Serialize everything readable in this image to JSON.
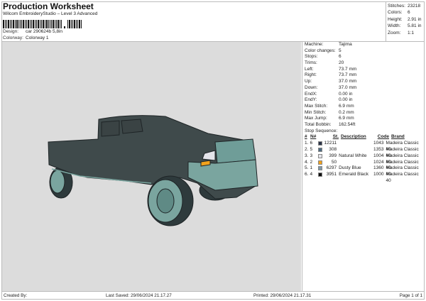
{
  "header": {
    "title": "Production Worksheet",
    "subtitle": "Wilcom EmbroideryStudio – Level 3 Advanced",
    "design_label": "Design:",
    "design_value": "car 290624b 5,8in",
    "colorway_label": "Colorway:",
    "colorway_value": "Colorway 1"
  },
  "stats": [
    {
      "label": "Stitches:",
      "value": "23218"
    },
    {
      "label": "Colors:",
      "value": "6"
    },
    {
      "label": "Height:",
      "value": "2.91 in"
    },
    {
      "label": "Width:",
      "value": "5.81 in"
    },
    {
      "label": "Zoom:",
      "value": "1:1"
    }
  ],
  "details": [
    {
      "label": "Machine:",
      "value": "Tajima"
    },
    {
      "label": "Color changes:",
      "value": "5"
    },
    {
      "label": "Stops:",
      "value": "6"
    },
    {
      "label": "Trims:",
      "value": "20"
    },
    {
      "label": "Left:",
      "value": "73.7 mm"
    },
    {
      "label": "Right:",
      "value": "73.7 mm"
    },
    {
      "label": "Up:",
      "value": "37.0 mm"
    },
    {
      "label": "Down:",
      "value": "37.0 mm"
    },
    {
      "label": "EndX:",
      "value": "0.00 in"
    },
    {
      "label": "EndY:",
      "value": "0.00 in"
    },
    {
      "label": "Max Stitch:",
      "value": "6.9 mm"
    },
    {
      "label": "Min Stitch:",
      "value": "0.2 mm"
    },
    {
      "label": "Max Jump:",
      "value": "6.9 mm"
    },
    {
      "label": "Total Bobbin:",
      "value": "162.54ft"
    }
  ],
  "stop_sequence": {
    "title": "Stop Sequence:",
    "headers": [
      "#",
      "N#",
      "St.",
      "Description",
      "Code",
      "Brand"
    ],
    "rows": [
      {
        "num": "1.",
        "n": "6",
        "color": "#2b3347",
        "st": "12211",
        "desc": "",
        "code": "1043",
        "brand": "Madeira Classic 40"
      },
      {
        "num": "2.",
        "n": "5",
        "color": "#4e6a80",
        "st": "308",
        "desc": "",
        "code": "1353",
        "brand": "Madeira Classic 40"
      },
      {
        "num": "3.",
        "n": "3",
        "color": "#e4e4ea",
        "st": "399",
        "desc": "Natural White",
        "code": "1004",
        "brand": "Madeira Classic 40"
      },
      {
        "num": "4.",
        "n": "2",
        "color": "#f2a21c",
        "st": "50",
        "desc": "",
        "code": "1024",
        "brand": "Madeira Classic 40"
      },
      {
        "num": "5.",
        "n": "1",
        "color": "#7f98a8",
        "st": "6297",
        "desc": "Dusty Blue",
        "code": "1360",
        "brand": "Madeira Classic 40"
      },
      {
        "num": "6.",
        "n": "4",
        "color": "#111111",
        "st": "3951",
        "desc": "Emerald Black",
        "code": "1000",
        "brand": "Madeira Classic 40"
      }
    ]
  },
  "footer": {
    "created": "Created By:",
    "saved": "Last Saved: 29/06/2024 21.17.27",
    "printed": "Printed: 29/06/2024 21.17.31",
    "page": "Page 1 of 1"
  }
}
